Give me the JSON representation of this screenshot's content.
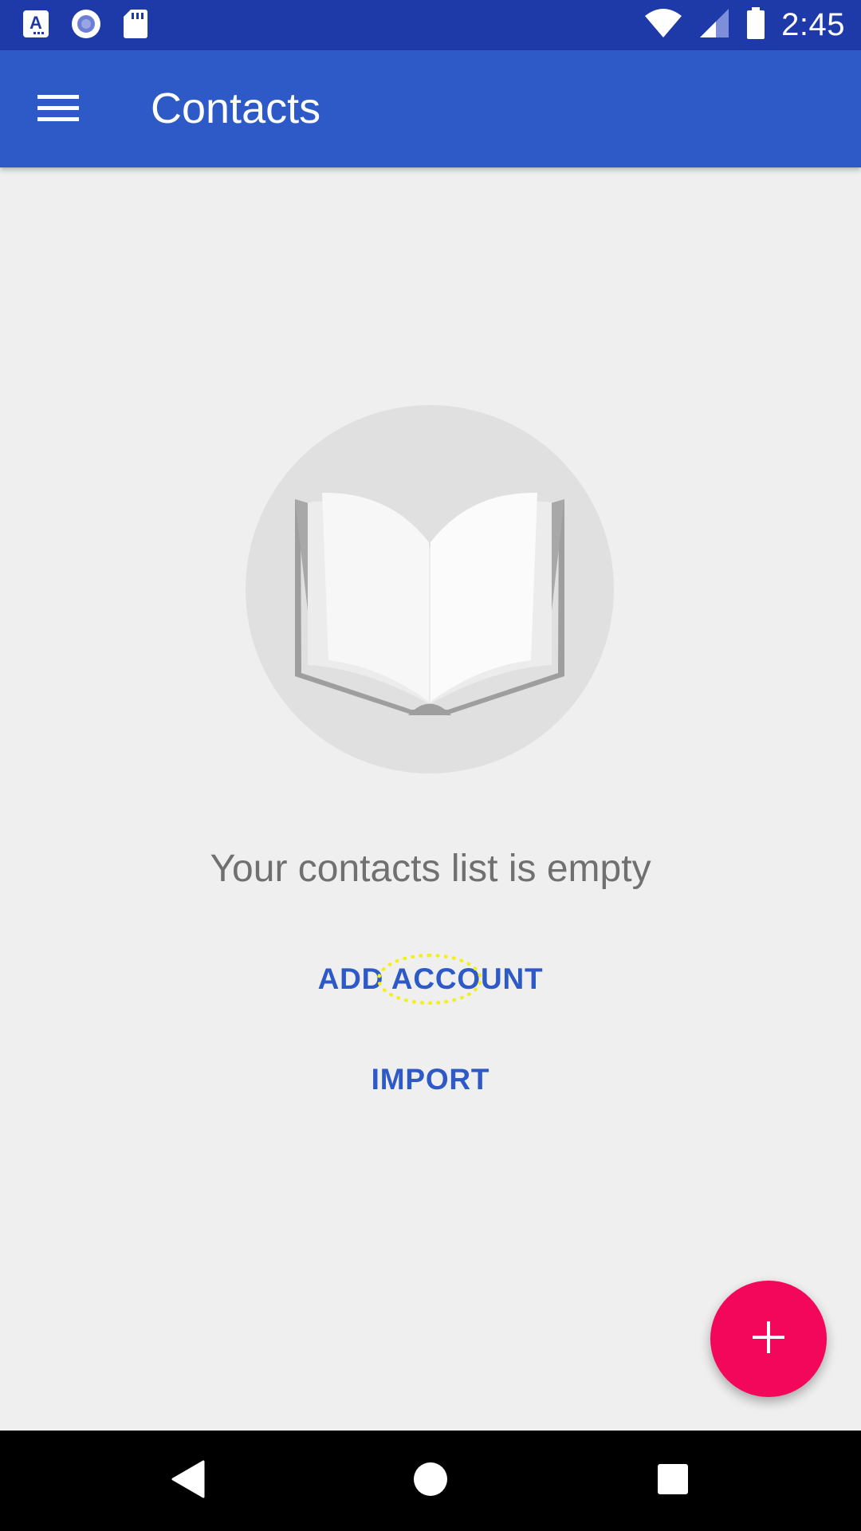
{
  "status_bar": {
    "time": "2:45",
    "left_icons": [
      "font-download-icon",
      "record-circle-icon",
      "sd-card-icon"
    ],
    "right_icons": [
      "wifi-icon",
      "cellular-signal-icon",
      "battery-icon"
    ]
  },
  "app_bar": {
    "title": "Contacts",
    "menu_icon": "hamburger-menu-icon"
  },
  "empty_state": {
    "illustration": "open-book-icon",
    "message": "Your contacts list is empty",
    "add_account_label": "ADD ACCOUNT",
    "import_label": "IMPORT"
  },
  "fab": {
    "icon": "plus-icon",
    "color": "#f2075a"
  },
  "colors": {
    "status_bar": "#1e3aa8",
    "primary": "#2d5ac6",
    "background": "#efefef",
    "accent": "#f2075a"
  },
  "nav_bar": {
    "buttons": [
      "back-icon",
      "home-icon",
      "recents-icon"
    ]
  }
}
